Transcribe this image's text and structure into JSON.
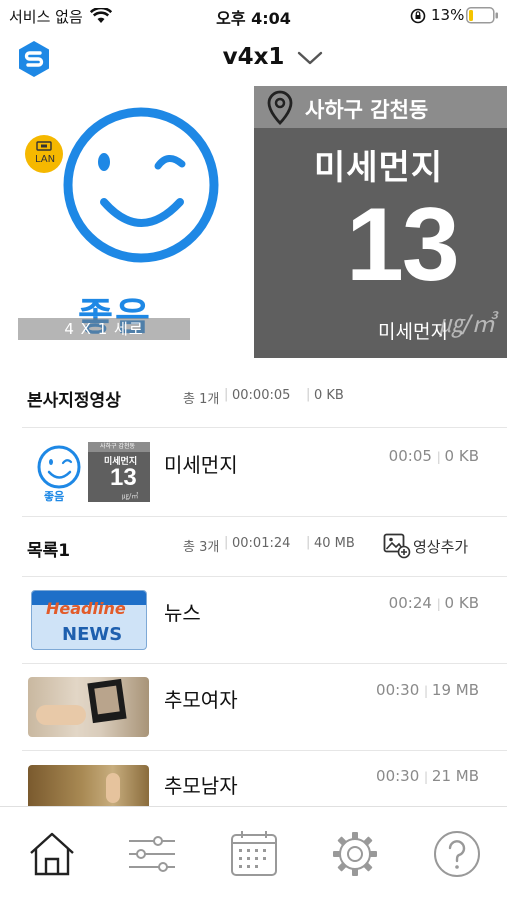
{
  "status_bar": {
    "carrier": "서비스 없음",
    "time": "오후 4:04",
    "battery": "13%"
  },
  "header": {
    "title": "v4x1"
  },
  "preview": {
    "location": "사하구 감천동",
    "pm_title": "미세먼지",
    "pm_value": "13",
    "pm_label": "미세먼지",
    "pm_unit": "㎍/㎥",
    "grade_text": "좋음",
    "lan_label": "LAN",
    "overlay_label": "4 X 1 세로"
  },
  "sections": [
    {
      "title": "본사지정영상",
      "count": "총 1개",
      "duration": "00:00:05",
      "size": "0 KB",
      "items": [
        {
          "title": "미세먼지",
          "time": "00:05",
          "size": "0 KB",
          "thumb_location": "사하구 감천동",
          "thumb_title": "미세먼지",
          "thumb_value": "13",
          "thumb_unit": "㎍/㎥",
          "thumb_grade": "좋음"
        }
      ]
    },
    {
      "title": "목록1",
      "count": "총 3개",
      "duration": "00:01:24",
      "size": "40 MB",
      "add_label": "영상추가",
      "items": [
        {
          "title": "뉴스",
          "time": "00:24",
          "size": "0 KB",
          "thumb_top": "Headline",
          "thumb_bottom": "NEWS"
        },
        {
          "title": "추모여자",
          "time": "00:30",
          "size": "19 MB"
        },
        {
          "title": "추모남자",
          "time": "00:30",
          "size": "21 MB"
        }
      ]
    }
  ],
  "colors": {
    "accent": "#1e88e5",
    "panel": "#5f5f5f",
    "panel_header": "#8c8c8c",
    "badge": "#f5b800"
  },
  "tabs": [
    {
      "icon": "home-icon",
      "name": "home"
    },
    {
      "icon": "sliders-icon",
      "name": "controls"
    },
    {
      "icon": "calendar-icon",
      "name": "schedule"
    },
    {
      "icon": "gear-icon",
      "name": "settings"
    },
    {
      "icon": "help-icon",
      "name": "help"
    }
  ]
}
